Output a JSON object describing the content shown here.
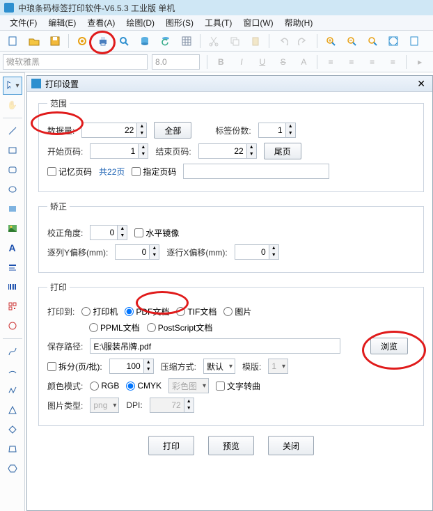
{
  "app": {
    "title": "中琅条码标签打印软件-V6.5.3 工业版 单机"
  },
  "menu": {
    "file": "文件(F)",
    "edit": "编辑(E)",
    "view": "查看(A)",
    "draw": "绘图(D)",
    "shape": "图形(S)",
    "tool": "工具(T)",
    "window": "窗口(W)",
    "help": "帮助(H)"
  },
  "fontbar": {
    "font": "微软雅黑",
    "size": "8.0",
    "b": "B",
    "i": "I",
    "u": "U",
    "s": "S",
    "a": "A"
  },
  "dialog": {
    "title": "打印设置",
    "range": {
      "legend": "范围",
      "data_label": "数据量:",
      "data_value": "22",
      "all_btn": "全部",
      "copies_label": "标签份数:",
      "copies_value": "1",
      "start_label": "开始页码:",
      "start_value": "1",
      "end_label": "结束页码:",
      "end_value": "22",
      "tail_btn": "尾页",
      "remember": "记忆页码",
      "total": "共22页",
      "spec": "指定页码"
    },
    "correct": {
      "legend": "矫正",
      "angle_label": "校正角度:",
      "angle_value": "0",
      "mirror": "水平镜像",
      "yoff_label": "逐列Y偏移(mm):",
      "yoff_value": "0",
      "xoff_label": "逐行X偏移(mm):",
      "xoff_value": "0"
    },
    "print": {
      "legend": "打印",
      "to_label": "打印到:",
      "opt_printer": "打印机",
      "opt_pdf": "PDF文档",
      "opt_tif": "TIF文档",
      "opt_img": "图片",
      "opt_ppml": "PPML文档",
      "opt_ps": "PostScript文档",
      "path_label": "保存路径:",
      "path_value": "E:\\服装吊牌.pdf",
      "browse": "浏览",
      "split": "拆分(页/批):",
      "split_value": "100",
      "compress_label": "压缩方式:",
      "compress_value": "默认",
      "template_label": "模版:",
      "template_value": "1",
      "color_label": "颜色模式:",
      "rgb": "RGB",
      "cmyk": "CMYK",
      "colorimg": "彩色图",
      "textcurve": "文字转曲",
      "imgtype_label": "图片类型:",
      "imgtype_value": "png",
      "dpi_label": "DPI:",
      "dpi_value": "72"
    },
    "footer": {
      "print": "打印",
      "preview": "预览",
      "close": "关闭"
    }
  }
}
